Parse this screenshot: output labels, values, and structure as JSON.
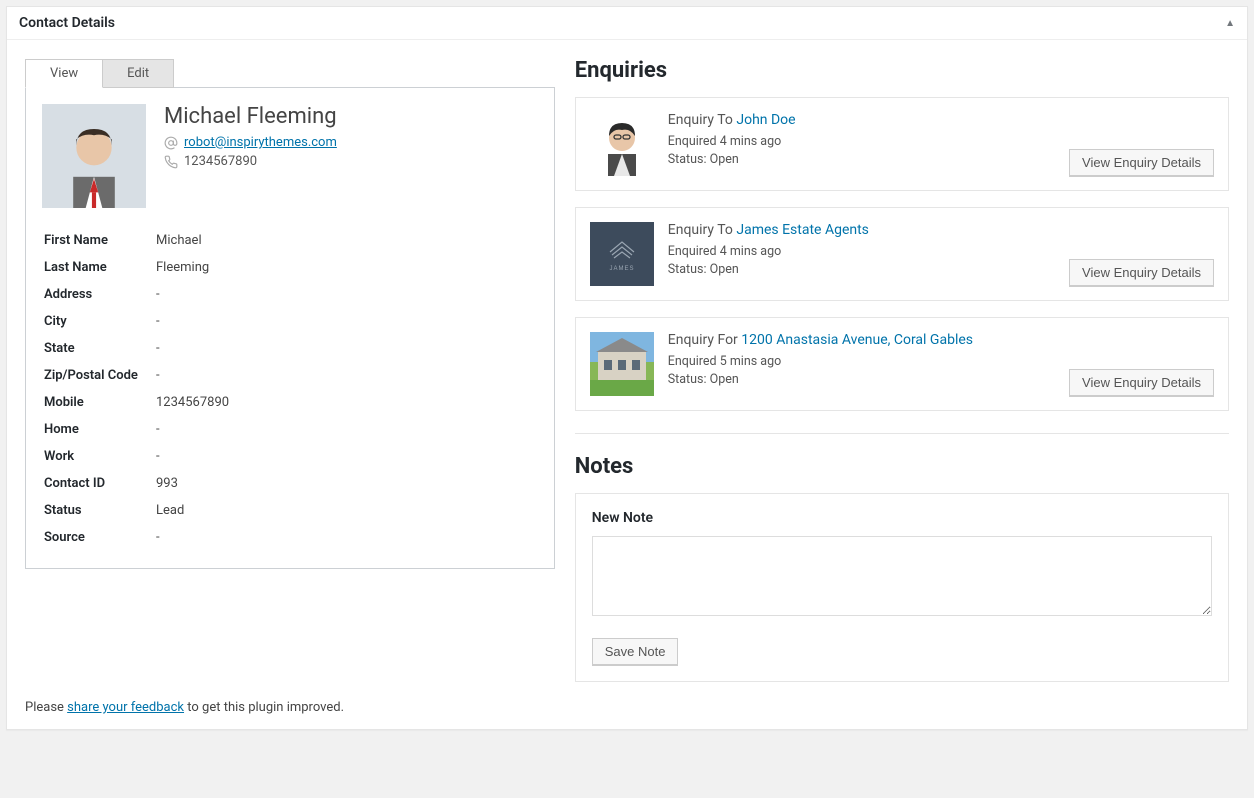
{
  "panel": {
    "title": "Contact Details"
  },
  "tabs": {
    "view": "View",
    "edit": "Edit"
  },
  "profile": {
    "name": "Michael Fleeming",
    "email": "robot@inspirythemes.com",
    "phone": "1234567890"
  },
  "details": [
    {
      "label": "First Name",
      "value": "Michael"
    },
    {
      "label": "Last Name",
      "value": "Fleeming"
    },
    {
      "label": "Address",
      "value": "-"
    },
    {
      "label": "City",
      "value": "-"
    },
    {
      "label": "State",
      "value": "-"
    },
    {
      "label": "Zip/Postal Code",
      "value": "-"
    },
    {
      "label": "Mobile",
      "value": "1234567890"
    },
    {
      "label": "Home",
      "value": "-"
    },
    {
      "label": "Work",
      "value": "-"
    },
    {
      "label": "Contact ID",
      "value": "993"
    },
    {
      "label": "Status",
      "value": "Lead"
    },
    {
      "label": "Source",
      "value": "-"
    }
  ],
  "enquiries": {
    "heading": "Enquiries",
    "view_btn": "View Enquiry Details",
    "items": [
      {
        "prefix": "Enquiry To",
        "link": "John Doe",
        "time": "Enquired 4 mins ago",
        "status": "Status: Open"
      },
      {
        "prefix": "Enquiry To",
        "link": "James Estate Agents",
        "time": "Enquired 4 mins ago",
        "status": "Status: Open"
      },
      {
        "prefix": "Enquiry For",
        "link": "1200 Anastasia Avenue, Coral Gables",
        "time": "Enquired 5 mins ago",
        "status": "Status: Open"
      }
    ]
  },
  "notes": {
    "heading": "Notes",
    "new_label": "New Note",
    "save_btn": "Save Note"
  },
  "footer": {
    "before": "Please ",
    "link": "share your feedback",
    "after": " to get this plugin improved."
  }
}
